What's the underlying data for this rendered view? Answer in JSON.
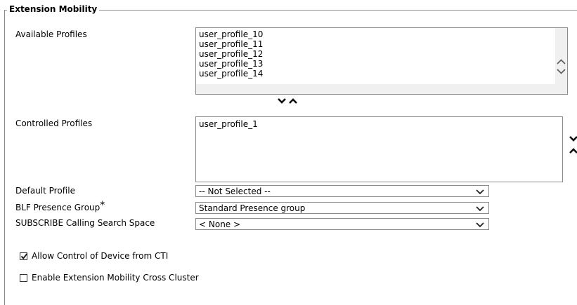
{
  "section": {
    "title": "Extension Mobility"
  },
  "available_profiles": {
    "label": "Available Profiles",
    "options": [
      "user_profile_10",
      "user_profile_11",
      "user_profile_12",
      "user_profile_13",
      "user_profile_14"
    ]
  },
  "controlled_profiles": {
    "label": "Controlled Profiles",
    "options": [
      "user_profile_1"
    ]
  },
  "move_buttons": {
    "down": "⌄",
    "up": "⌃"
  },
  "default_profile": {
    "label": "Default Profile",
    "value": "-- Not Selected --"
  },
  "blf_presence_group": {
    "label": "BLF Presence Group",
    "required_mark": "*",
    "value": "Standard Presence group"
  },
  "subscribe_css": {
    "label": "SUBSCRIBE Calling Search Space",
    "value": "< None >"
  },
  "allow_cti": {
    "label": "Allow Control of Device from CTI",
    "checked": true
  },
  "enable_em_cross_cluster": {
    "label": "Enable Extension Mobility Cross Cluster",
    "checked": false
  }
}
